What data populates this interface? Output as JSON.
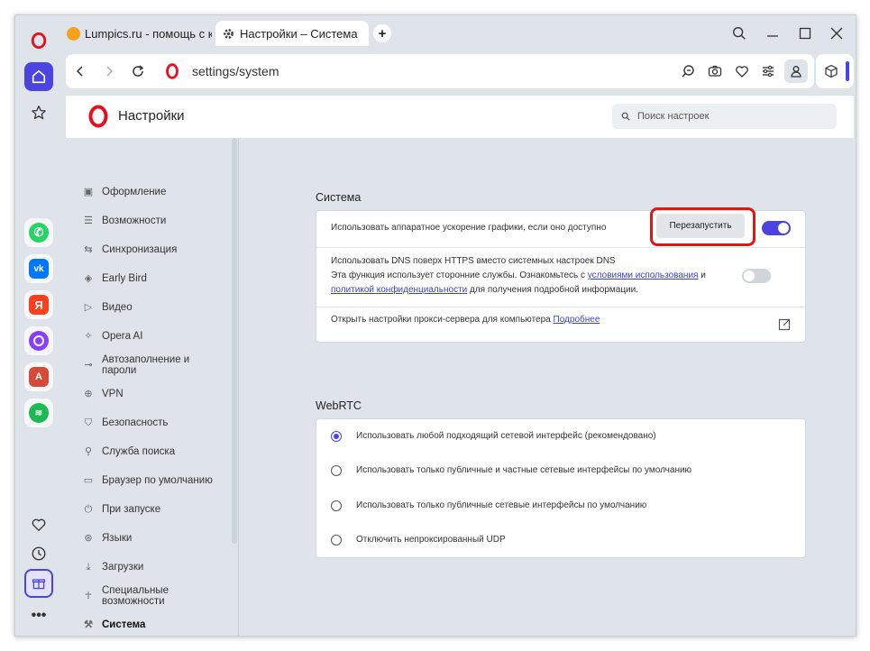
{
  "tabs": [
    {
      "title": "Lumpics.ru - помощь с ко",
      "icon": "orange-site-icon"
    },
    {
      "title": "Настройки – Система",
      "icon": "gear-icon"
    }
  ],
  "address": {
    "url": "settings/system"
  },
  "page": {
    "title": "Настройки",
    "search_placeholder": "Поиск настроек"
  },
  "nav": {
    "items": [
      {
        "label": "Оформление",
        "icon": "appearance-icon"
      },
      {
        "label": "Возможности",
        "icon": "features-icon"
      },
      {
        "label": "Синхронизация",
        "icon": "sync-icon"
      },
      {
        "label": "Early Bird",
        "icon": "early-bird-icon"
      },
      {
        "label": "Видео",
        "icon": "video-icon"
      },
      {
        "label": "Opera AI",
        "icon": "opera-ai-icon"
      },
      {
        "label": "Автозаполнение и пароли",
        "icon": "key-icon"
      },
      {
        "label": "VPN",
        "icon": "vpn-icon"
      },
      {
        "label": "Безопасность",
        "icon": "shield-icon"
      },
      {
        "label": "Служба поиска",
        "icon": "search-icon"
      },
      {
        "label": "Браузер по умолчанию",
        "icon": "browser-icon"
      },
      {
        "label": "При запуске",
        "icon": "power-icon"
      },
      {
        "label": "Языки",
        "icon": "languages-icon"
      },
      {
        "label": "Загрузки",
        "icon": "download-icon"
      },
      {
        "label": "Специальные возможности",
        "icon": "accessibility-icon"
      },
      {
        "label": "Система",
        "icon": "wrench-icon"
      }
    ]
  },
  "system": {
    "title": "Система",
    "hw_accel_label": "Использовать аппаратное ускорение графики, если оно доступно",
    "restart_label": "Перезапустить",
    "hw_accel_enabled": true,
    "dns_line1": "Использовать DNS поверх HTTPS вместо системных настроек DNS",
    "dns_line2_pre": "Эта функция использует сторонние службы. Ознакомьтесь с ",
    "dns_terms_link": "условиями использования",
    "dns_line2_post": " и",
    "dns_privacy_link": "политикой конфиденциальности",
    "dns_line3_post": " для получения подробной информации.",
    "dns_enabled": false,
    "proxy_label": "Открыть настройки прокси-сервера для компьютера ",
    "proxy_link": "Подробнее"
  },
  "webrtc": {
    "title": "WebRTC",
    "options": [
      "Использовать любой подходящий сетевой интерфейс (рекомендовано)",
      "Использовать только публичные и частные сетевые интерфейсы по умолчанию",
      "Использовать только публичные сетевые интерфейсы по умолчанию",
      "Отключить непроксированный UDP"
    ],
    "selected": 0
  },
  "colors": {
    "accent": "#4b44e0",
    "opera_red": "#e5121e",
    "highlight": "#e01515"
  }
}
